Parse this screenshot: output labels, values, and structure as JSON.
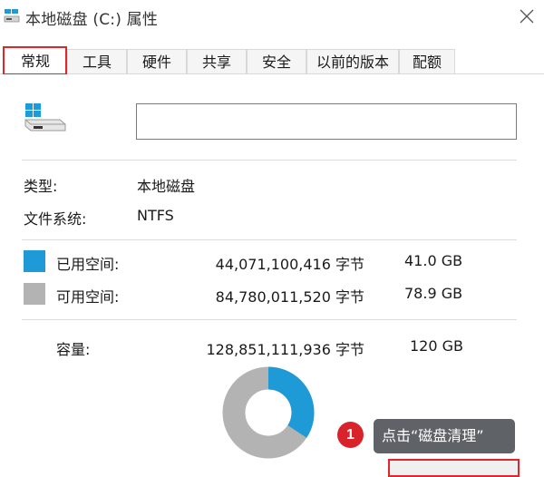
{
  "window": {
    "title": "本地磁盘 (C:) 属性"
  },
  "tabs": [
    {
      "label": "常规",
      "active": true
    },
    {
      "label": "工具"
    },
    {
      "label": "硬件"
    },
    {
      "label": "共享"
    },
    {
      "label": "安全"
    },
    {
      "label": "以前的版本"
    },
    {
      "label": "配额"
    }
  ],
  "general": {
    "drive_name_value": "",
    "type_label": "类型:",
    "type_value": "本地磁盘",
    "fs_label": "文件系统:",
    "fs_value": "NTFS"
  },
  "space": {
    "used_label": "已用空间:",
    "used_bytes": "44,071,100,416 字节",
    "used_size": "41.0 GB",
    "free_label": "可用空间:",
    "free_bytes": "84,780,011,520 字节",
    "free_size": "78.9 GB",
    "capacity_label": "容量:",
    "capacity_bytes": "128,851,111,936 字节",
    "capacity_size": "120 GB",
    "used_fraction": 0.342,
    "used_color": "#1e9ad6",
    "free_color": "#b3b3b3"
  },
  "annotation": {
    "step_number": "1",
    "hint_text": "点击“磁盘清理”",
    "accent_color": "#e0262b"
  }
}
